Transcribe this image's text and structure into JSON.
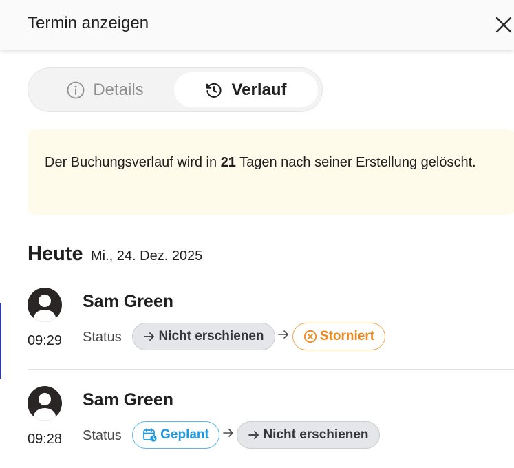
{
  "header": {
    "title": "Termin anzeigen"
  },
  "tabs": [
    {
      "label": "Details",
      "icon": "info-icon",
      "active": false
    },
    {
      "label": "Verlauf",
      "icon": "history-icon",
      "active": true
    }
  ],
  "notice": {
    "text_before": "Der Buchungsverlauf wird in ",
    "days": "21",
    "text_after": " Tagen nach seiner Erstellung gelöscht.",
    "background": "#fffbea"
  },
  "day": {
    "title": "Heute",
    "date": "Mi., 24. Dez. 2025"
  },
  "entries": [
    {
      "name": "Sam Green",
      "time": "09:29",
      "status_label": "Status",
      "from": {
        "label": "Nicht erschienen",
        "icon": "arrow-right-icon",
        "color": "#33373d"
      },
      "to": {
        "label": "Storniert",
        "icon": "x-circle-icon",
        "color": "#ea8a1f"
      }
    },
    {
      "name": "Sam Green",
      "time": "09:28",
      "status_label": "Status",
      "from": {
        "label": "Geplant",
        "icon": "calendar-clock-icon",
        "color": "#1f9ae0"
      },
      "to": {
        "label": "Nicht erschienen",
        "icon": "arrow-right-icon",
        "color": "#33373d"
      }
    }
  ]
}
